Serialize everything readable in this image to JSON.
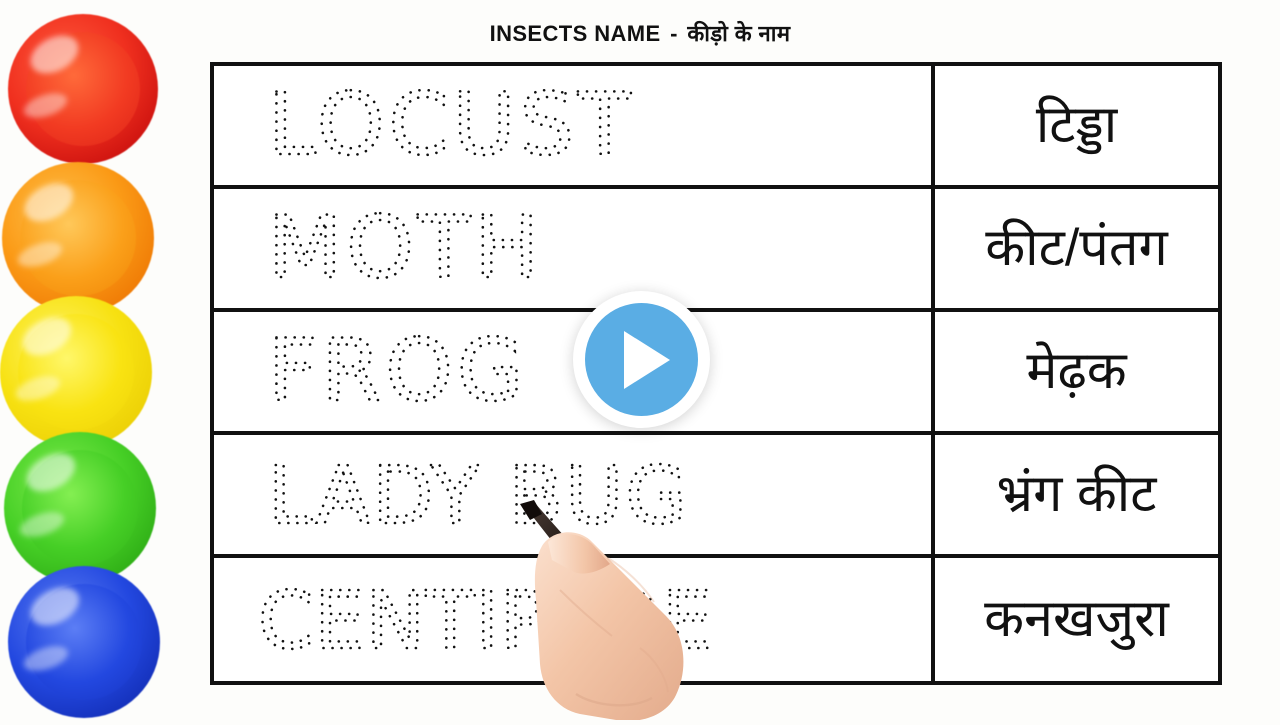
{
  "header": {
    "title_en": "INSECTS NAME",
    "separator": "-",
    "title_hi": "कीड़ो के नाम"
  },
  "worksheet": {
    "columns": [
      "English tracing word",
      "Hindi meaning"
    ],
    "rows": [
      {
        "english": "LOCUST",
        "hindi": "टिड्डा"
      },
      {
        "english": "MOTH",
        "hindi": "कीट/पंतग"
      },
      {
        "english": "FROG",
        "hindi": "मेढ़क"
      },
      {
        "english": "LADY BUG",
        "hindi": "भ्रंग  कीट"
      },
      {
        "english": "CENTIPEDE",
        "hindi": "कनखजुरा"
      }
    ]
  },
  "overlay": {
    "play_button_label": "Play",
    "play_icon": "play-triangle-icon",
    "play_circle_color": "#5aade4",
    "play_ring_color": "#ffffff"
  },
  "decor": {
    "paint_pots": [
      {
        "name": "red-paint-pot",
        "color": "#ee2a1e",
        "inner": "#f23b22"
      },
      {
        "name": "orange-paint-pot",
        "color": "#f79310",
        "inner": "#fba01a"
      },
      {
        "name": "yellow-paint-pot",
        "color": "#f5dc0a",
        "inner": "#f9e312"
      },
      {
        "name": "green-paint-pot",
        "color": "#3fc222",
        "inner": "#46cf26"
      },
      {
        "name": "blue-paint-pot",
        "color": "#1d3ed6",
        "inner": "#2348e0"
      }
    ],
    "hand": {
      "name": "hand-with-marker",
      "skin_color": "#f4c4a8",
      "marker_color": "#1d1512",
      "marker_band_color": "#d8d8d8"
    },
    "background_color": "#fdfdfb",
    "table_border_color": "#111111",
    "table_fill_color": "#ffffff"
  }
}
